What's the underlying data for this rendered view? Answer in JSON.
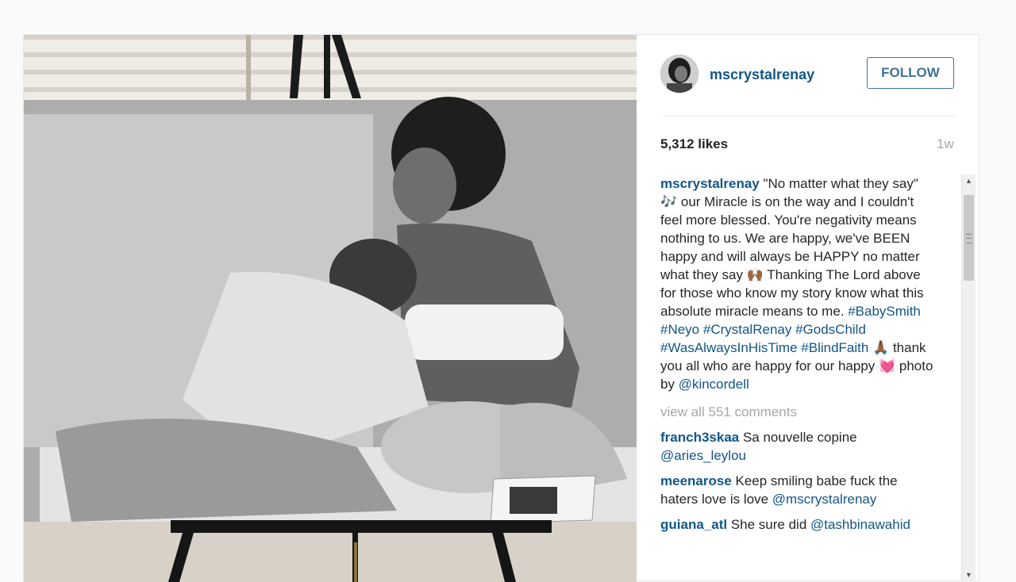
{
  "post": {
    "username": "mscrystalrenay",
    "follow_label": "FOLLOW",
    "likes": "5,312 likes",
    "age": "1w",
    "caption": {
      "author": "mscrystalrenay",
      "text1": " \"No matter what they say\" 🎶 our Miracle is on the way and I couldn't feel more blessed. You're negativity means nothing to us. We are happy, we've BEEN happy and will always be HAPPY no matter what they say 🙌🏾 Thanking The Lord above for those who know my story know what this absolute miracle means to me. ",
      "hashtags1": "#BabySmith #Neyo #CrystalRenay #GodsChild #WasAlwaysInHisTime #BlindFaith",
      "text2": " 🙏🏾 thank you all who are happy for our happy 💓 photo by ",
      "mention": "@kincordell"
    },
    "view_all": "view all 551 comments",
    "comments": [
      {
        "user": "franch3skaa",
        "text": " Sa nouvelle copine ",
        "mention": "@aries_leylou"
      },
      {
        "user": "meenarose",
        "text": " Keep smiling babe fuck the haters love is love ",
        "mention": "@mscrystalrenay"
      },
      {
        "user": "guiana_atl",
        "text": " She sure did ",
        "mention": "@tashbinawahid"
      }
    ]
  },
  "colors": {
    "link": "#125688",
    "follow": "#3f729b",
    "muted": "#a5a7aa"
  }
}
